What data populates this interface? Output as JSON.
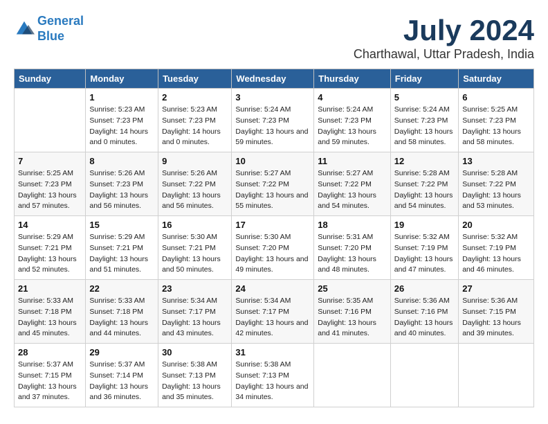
{
  "logo": {
    "line1": "General",
    "line2": "Blue"
  },
  "title": "July 2024",
  "subtitle": "Charthawal, Uttar Pradesh, India",
  "days_header": [
    "Sunday",
    "Monday",
    "Tuesday",
    "Wednesday",
    "Thursday",
    "Friday",
    "Saturday"
  ],
  "weeks": [
    [
      {
        "day": "",
        "sunrise": "",
        "sunset": "",
        "daylight": ""
      },
      {
        "day": "1",
        "sunrise": "Sunrise: 5:23 AM",
        "sunset": "Sunset: 7:23 PM",
        "daylight": "Daylight: 14 hours and 0 minutes."
      },
      {
        "day": "2",
        "sunrise": "Sunrise: 5:23 AM",
        "sunset": "Sunset: 7:23 PM",
        "daylight": "Daylight: 14 hours and 0 minutes."
      },
      {
        "day": "3",
        "sunrise": "Sunrise: 5:24 AM",
        "sunset": "Sunset: 7:23 PM",
        "daylight": "Daylight: 13 hours and 59 minutes."
      },
      {
        "day": "4",
        "sunrise": "Sunrise: 5:24 AM",
        "sunset": "Sunset: 7:23 PM",
        "daylight": "Daylight: 13 hours and 59 minutes."
      },
      {
        "day": "5",
        "sunrise": "Sunrise: 5:24 AM",
        "sunset": "Sunset: 7:23 PM",
        "daylight": "Daylight: 13 hours and 58 minutes."
      },
      {
        "day": "6",
        "sunrise": "Sunrise: 5:25 AM",
        "sunset": "Sunset: 7:23 PM",
        "daylight": "Daylight: 13 hours and 58 minutes."
      }
    ],
    [
      {
        "day": "7",
        "sunrise": "Sunrise: 5:25 AM",
        "sunset": "Sunset: 7:23 PM",
        "daylight": "Daylight: 13 hours and 57 minutes."
      },
      {
        "day": "8",
        "sunrise": "Sunrise: 5:26 AM",
        "sunset": "Sunset: 7:23 PM",
        "daylight": "Daylight: 13 hours and 56 minutes."
      },
      {
        "day": "9",
        "sunrise": "Sunrise: 5:26 AM",
        "sunset": "Sunset: 7:22 PM",
        "daylight": "Daylight: 13 hours and 56 minutes."
      },
      {
        "day": "10",
        "sunrise": "Sunrise: 5:27 AM",
        "sunset": "Sunset: 7:22 PM",
        "daylight": "Daylight: 13 hours and 55 minutes."
      },
      {
        "day": "11",
        "sunrise": "Sunrise: 5:27 AM",
        "sunset": "Sunset: 7:22 PM",
        "daylight": "Daylight: 13 hours and 54 minutes."
      },
      {
        "day": "12",
        "sunrise": "Sunrise: 5:28 AM",
        "sunset": "Sunset: 7:22 PM",
        "daylight": "Daylight: 13 hours and 54 minutes."
      },
      {
        "day": "13",
        "sunrise": "Sunrise: 5:28 AM",
        "sunset": "Sunset: 7:22 PM",
        "daylight": "Daylight: 13 hours and 53 minutes."
      }
    ],
    [
      {
        "day": "14",
        "sunrise": "Sunrise: 5:29 AM",
        "sunset": "Sunset: 7:21 PM",
        "daylight": "Daylight: 13 hours and 52 minutes."
      },
      {
        "day": "15",
        "sunrise": "Sunrise: 5:29 AM",
        "sunset": "Sunset: 7:21 PM",
        "daylight": "Daylight: 13 hours and 51 minutes."
      },
      {
        "day": "16",
        "sunrise": "Sunrise: 5:30 AM",
        "sunset": "Sunset: 7:21 PM",
        "daylight": "Daylight: 13 hours and 50 minutes."
      },
      {
        "day": "17",
        "sunrise": "Sunrise: 5:30 AM",
        "sunset": "Sunset: 7:20 PM",
        "daylight": "Daylight: 13 hours and 49 minutes."
      },
      {
        "day": "18",
        "sunrise": "Sunrise: 5:31 AM",
        "sunset": "Sunset: 7:20 PM",
        "daylight": "Daylight: 13 hours and 48 minutes."
      },
      {
        "day": "19",
        "sunrise": "Sunrise: 5:32 AM",
        "sunset": "Sunset: 7:19 PM",
        "daylight": "Daylight: 13 hours and 47 minutes."
      },
      {
        "day": "20",
        "sunrise": "Sunrise: 5:32 AM",
        "sunset": "Sunset: 7:19 PM",
        "daylight": "Daylight: 13 hours and 46 minutes."
      }
    ],
    [
      {
        "day": "21",
        "sunrise": "Sunrise: 5:33 AM",
        "sunset": "Sunset: 7:18 PM",
        "daylight": "Daylight: 13 hours and 45 minutes."
      },
      {
        "day": "22",
        "sunrise": "Sunrise: 5:33 AM",
        "sunset": "Sunset: 7:18 PM",
        "daylight": "Daylight: 13 hours and 44 minutes."
      },
      {
        "day": "23",
        "sunrise": "Sunrise: 5:34 AM",
        "sunset": "Sunset: 7:17 PM",
        "daylight": "Daylight: 13 hours and 43 minutes."
      },
      {
        "day": "24",
        "sunrise": "Sunrise: 5:34 AM",
        "sunset": "Sunset: 7:17 PM",
        "daylight": "Daylight: 13 hours and 42 minutes."
      },
      {
        "day": "25",
        "sunrise": "Sunrise: 5:35 AM",
        "sunset": "Sunset: 7:16 PM",
        "daylight": "Daylight: 13 hours and 41 minutes."
      },
      {
        "day": "26",
        "sunrise": "Sunrise: 5:36 AM",
        "sunset": "Sunset: 7:16 PM",
        "daylight": "Daylight: 13 hours and 40 minutes."
      },
      {
        "day": "27",
        "sunrise": "Sunrise: 5:36 AM",
        "sunset": "Sunset: 7:15 PM",
        "daylight": "Daylight: 13 hours and 39 minutes."
      }
    ],
    [
      {
        "day": "28",
        "sunrise": "Sunrise: 5:37 AM",
        "sunset": "Sunset: 7:15 PM",
        "daylight": "Daylight: 13 hours and 37 minutes."
      },
      {
        "day": "29",
        "sunrise": "Sunrise: 5:37 AM",
        "sunset": "Sunset: 7:14 PM",
        "daylight": "Daylight: 13 hours and 36 minutes."
      },
      {
        "day": "30",
        "sunrise": "Sunrise: 5:38 AM",
        "sunset": "Sunset: 7:13 PM",
        "daylight": "Daylight: 13 hours and 35 minutes."
      },
      {
        "day": "31",
        "sunrise": "Sunrise: 5:38 AM",
        "sunset": "Sunset: 7:13 PM",
        "daylight": "Daylight: 13 hours and 34 minutes."
      },
      {
        "day": "",
        "sunrise": "",
        "sunset": "",
        "daylight": ""
      },
      {
        "day": "",
        "sunrise": "",
        "sunset": "",
        "daylight": ""
      },
      {
        "day": "",
        "sunrise": "",
        "sunset": "",
        "daylight": ""
      }
    ]
  ]
}
